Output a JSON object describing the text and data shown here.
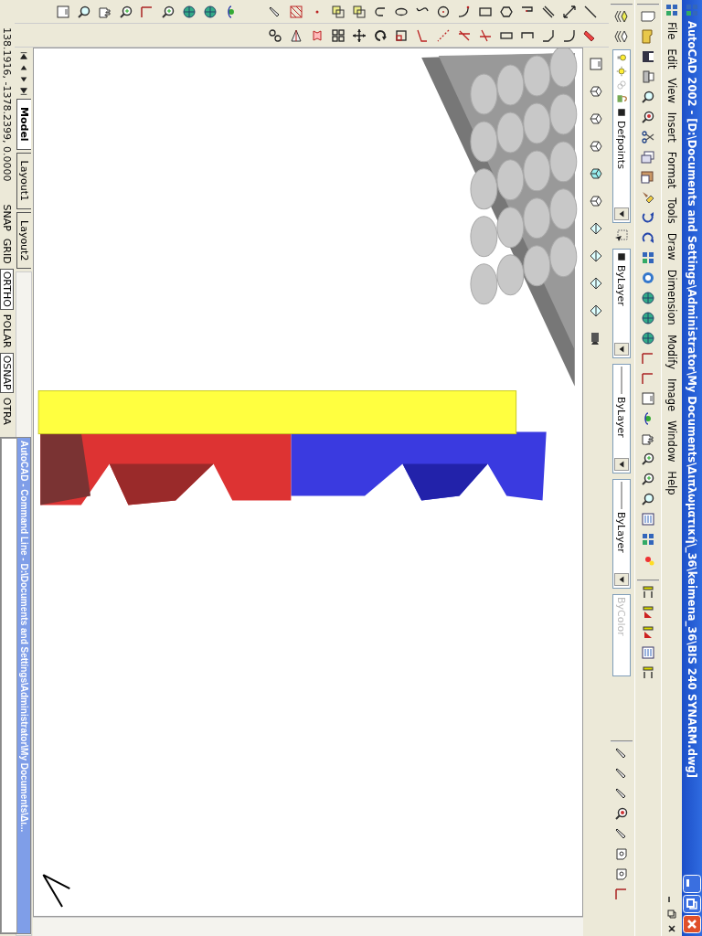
{
  "window": {
    "title": "AutoCAD 2002 - [D:\\Documents and Settings\\Administrator\\My Documents\\Διπλωματική\\_36\\keimena_36\\BIS 240 SYNARM.dwg]"
  },
  "menu": [
    "File",
    "Edit",
    "View",
    "Insert",
    "Format",
    "Tools",
    "Draw",
    "Dimension",
    "Modify",
    "Image",
    "Window",
    "Help"
  ],
  "layer_toolbar": {
    "layer": "Defpoints",
    "color_control": "ByLayer",
    "linetype": "ByLayer",
    "lineweight": "ByLayer",
    "plot_style": {
      "label": "ByColor",
      "disabled": true
    }
  },
  "layout_tabs": [
    {
      "label": "Model",
      "selected": true
    },
    {
      "label": "Layout1",
      "selected": false
    },
    {
      "label": "Layout2",
      "selected": false
    }
  ],
  "command_line": {
    "title": "AutoCAD - Command Line - D:\\Documents and Settings\\Administrator\\My Documents\\Δι..."
  },
  "status_bar": {
    "coordinates": "138.1916, -1378.2399, 0.0000",
    "toggles": [
      {
        "label": "SNAP",
        "on": false
      },
      {
        "label": "GRID",
        "on": false
      },
      {
        "label": "ORTHO",
        "on": true
      },
      {
        "label": "POLAR",
        "on": false
      },
      {
        "label": "OSNAP",
        "on": true
      },
      {
        "label": "OTRA",
        "on": false
      }
    ]
  }
}
